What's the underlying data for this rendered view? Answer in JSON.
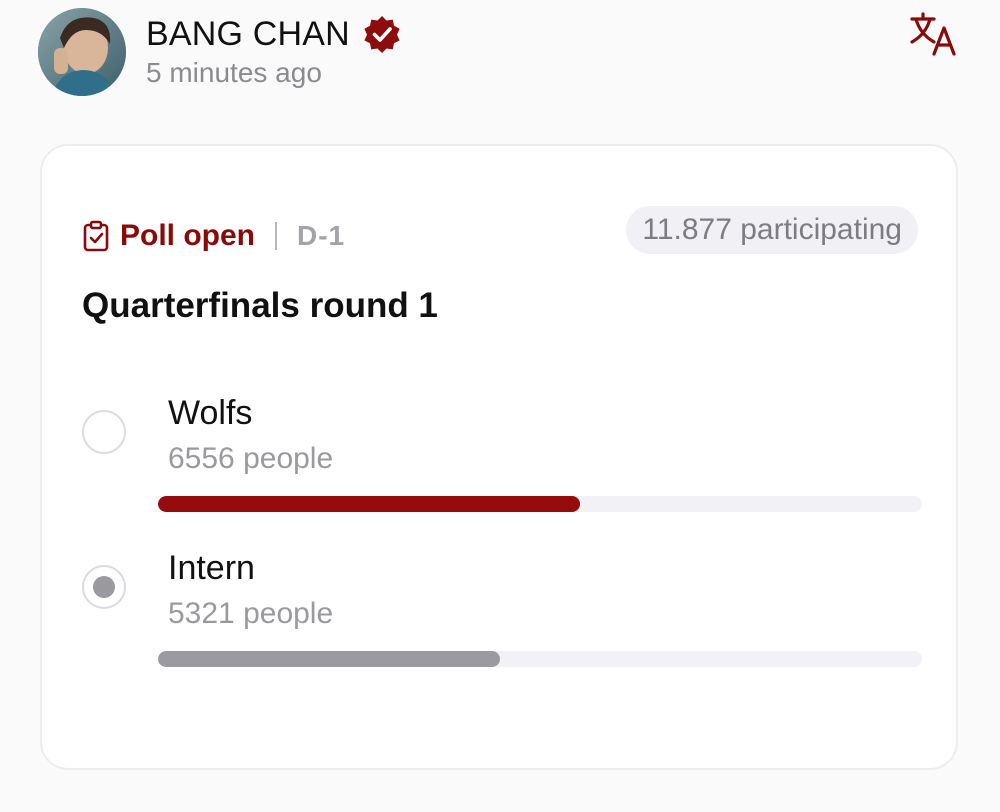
{
  "post": {
    "author": "BANG CHAN",
    "time": "5 minutes ago",
    "verified_icon": "verified-badge-icon",
    "translate_icon": "translate-icon"
  },
  "poll": {
    "status": "Poll open",
    "deadline": "D-1",
    "participants": "11.877 participating",
    "question": "Quarterfinals round 1",
    "options": [
      {
        "label": "Wolfs",
        "count": "6556 people",
        "share": 0.552,
        "selected": false,
        "bar_color": "#960b0b"
      },
      {
        "label": "Intern",
        "count": "5321 people",
        "share": 0.448,
        "selected": true,
        "bar_color": "#9b9b9f"
      }
    ]
  },
  "colors": {
    "accent": "#8a0a0a",
    "track": "#f1f1f6",
    "muted_text": "#8b8b8f"
  }
}
